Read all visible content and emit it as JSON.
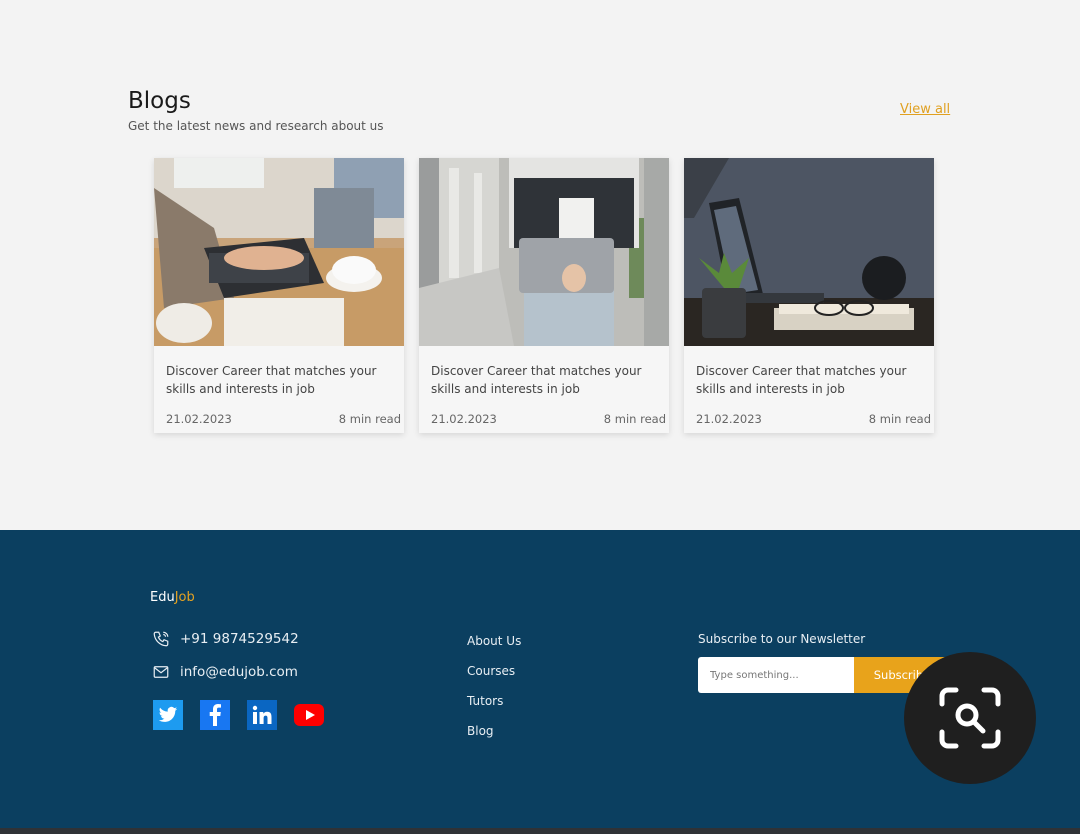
{
  "blogs": {
    "title": "Blogs",
    "subtitle": "Get the latest news and research about us",
    "view_all": "View all",
    "cards": [
      {
        "title": "Discover Career that matches your skills and interests in job",
        "date": "21.02.2023",
        "read_time": "8 min read",
        "image": "laptop-coffee-photo"
      },
      {
        "title": "Discover Career that matches your skills and interests in job",
        "date": "21.02.2023",
        "read_time": "8 min read",
        "image": "person-holding-laptop-photo"
      },
      {
        "title": "Discover Career that matches your skills and interests in job",
        "date": "21.02.2023",
        "read_time": "8 min read",
        "image": "desk-laptop-plant-photo"
      }
    ]
  },
  "footer": {
    "brand_part1": "Edu",
    "brand_part2": "Job",
    "phone": "+91 9874529542",
    "email": "info@edujob.com",
    "socials": [
      "twitter-icon",
      "facebook-icon",
      "linkedin-icon",
      "youtube-icon"
    ],
    "links": [
      "About Us",
      "Courses",
      "Tutors",
      "Blog"
    ],
    "newsletter_title": "Subscribe to our Newsletter",
    "newsletter_placeholder": "Type something...",
    "subscribe_label": "Subscribe"
  },
  "colors": {
    "footer_bg": "#0b3f60",
    "accent": "#e8a31b",
    "page_bg": "#f3f3f3"
  },
  "overlay": {
    "icon": "lens-search-icon"
  }
}
